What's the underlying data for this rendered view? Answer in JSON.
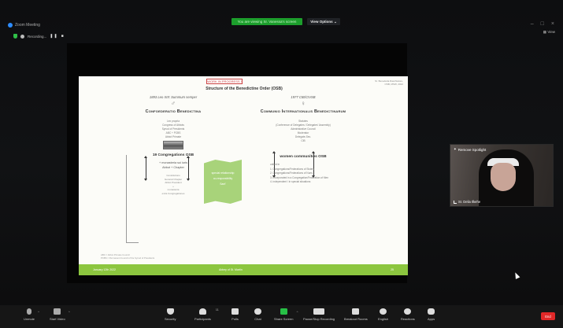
{
  "window": {
    "title": "Zoom Meeting",
    "share_banner": "You are viewing Sr. Vanessa's screen",
    "view_options": "View Options ⌄",
    "view_label": "View"
  },
  "status": {
    "recording_label": "Recording..."
  },
  "slide": {
    "tag": "WORK IN PROGRESS !",
    "right_note": "Sr. Benedetta Raschiatore, OSB, MSW, 2022",
    "title": "Structure of the Benedictine Order (OSB)",
    "left": {
      "date": "1893 Leo XIII: Summum semper",
      "symbol": "♂",
      "org": "Confoederatio Benedictina",
      "lines": [
        "Lex propria",
        "Congress of Abbots",
        "Synod of Presidents",
        "ABC + PCBS",
        "Abbot Primate"
      ],
      "congregations": "19 Congregations OSB",
      "monasteria": "+ monasteria sui iuris",
      "abbot_chapter": "Abbot + Chapter",
      "constitutions": [
        "Constitutions",
        "General Chapter",
        "Abbot President"
      ],
      "plus": "+",
      "monasteria2": [
        "monasteria",
        "extra Congregationes"
      ],
      "footnote": [
        "ABC = Abbot Primate Council",
        "PCBS = Permanent Council of the Synod of Presidents"
      ]
    },
    "center_banner": [
      "special relationship",
      "co-responsibility",
      "Sant'"
    ],
    "right": {
      "date": "1977 CIB/CIVSB",
      "symbol": "♀",
      "org": "Communio Internationalis Benedictinarum",
      "lines": [
        "Statutes",
        "(Conference of Delegates / Delegates' Assembly)",
        "Administrative Council",
        "Moderator",
        "Delegate-Sec.",
        "CIB"
      ],
      "communities": "women communities OSB",
      "list": [
        "united in",
        "1. Congregations/Federations of Sisters",
        "2. Congregations/Federations of Nuns",
        "3. incorporated in a Congregation/Federation of Men",
        "4. independent / in special situations"
      ]
    },
    "footer": {
      "left": "January 12th 2022",
      "center": "Abbey of St. Martin",
      "right": "25"
    }
  },
  "video": {
    "spotlight_label": "Remove Spotlight",
    "participant_name": "Sr. Delia Ilkehe"
  },
  "toolbar": {
    "items": [
      {
        "label": "Unmute"
      },
      {
        "label": "Start Video"
      },
      {
        "label": "Security"
      },
      {
        "label": "Participants",
        "count": "11"
      },
      {
        "label": "Polls"
      },
      {
        "label": "Chat"
      },
      {
        "label": "Share Screen"
      },
      {
        "label": "Pause/Stop Recording"
      },
      {
        "label": "Breakout Rooms"
      },
      {
        "label": "English"
      },
      {
        "label": "Reactions"
      },
      {
        "label": "Apps"
      }
    ],
    "end_label": "End"
  },
  "colors": {
    "share_green": "#1c9e2c",
    "slide_footer_green": "#8cc63f",
    "banner_green": "#a8d37a",
    "end_red": "#e02828"
  }
}
